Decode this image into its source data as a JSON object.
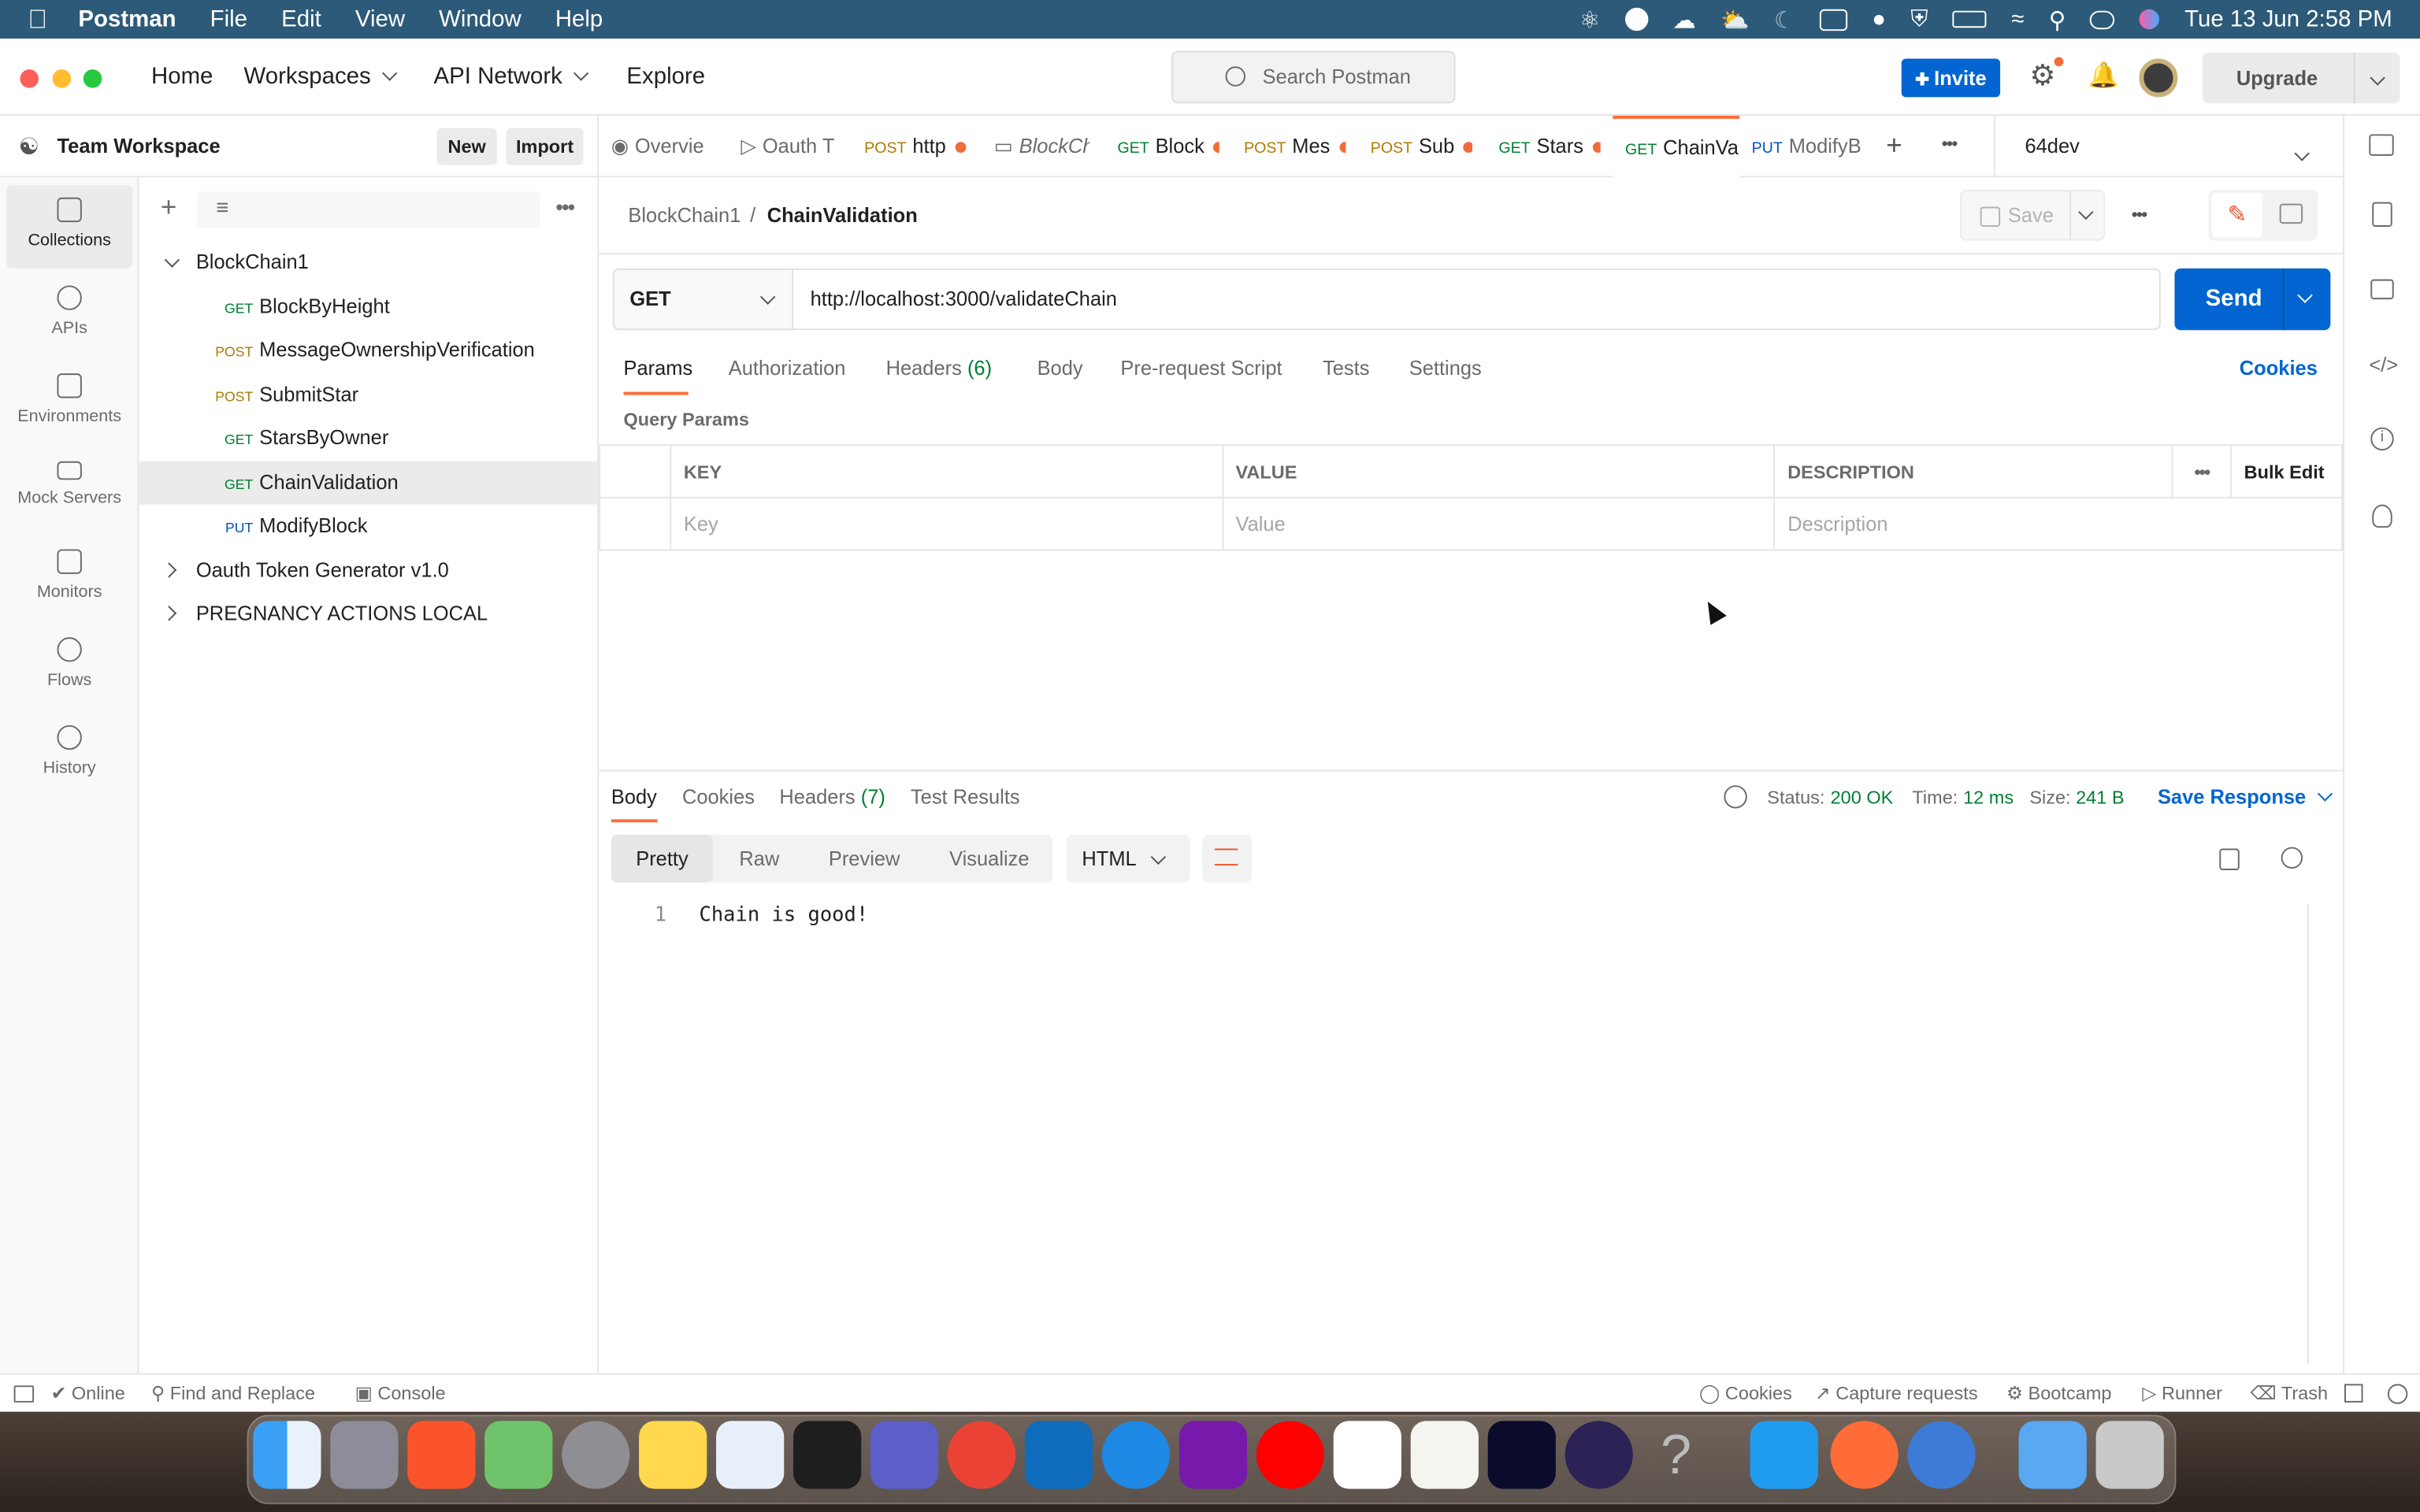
{
  "menubar": {
    "app": "Postman",
    "items": [
      "File",
      "Edit",
      "View",
      "Window",
      "Help"
    ],
    "clock": "Tue 13 Jun  2:58 PM"
  },
  "titlebar": {
    "nav": [
      "Home",
      "Workspaces",
      "API Network",
      "Explore"
    ],
    "search_placeholder": "Search Postman",
    "invite": "Invite",
    "upgrade": "Upgrade"
  },
  "workspace": {
    "name": "Team Workspace",
    "new": "New",
    "import": "Import"
  },
  "rail": [
    "Collections",
    "APIs",
    "Environments",
    "Mock Servers",
    "Monitors",
    "Flows",
    "History"
  ],
  "sidebar": {
    "collections": [
      {
        "name": "BlockChain1",
        "expanded": true
      },
      {
        "name": "Oauth Token Generator v1.0",
        "expanded": false
      },
      {
        "name": "PREGNANCY ACTIONS LOCAL",
        "expanded": false
      }
    ],
    "requests": [
      {
        "method": "GET",
        "name": "BlockByHeight"
      },
      {
        "method": "POST",
        "name": "MessageOwnershipVerification"
      },
      {
        "method": "POST",
        "name": "SubmitStar"
      },
      {
        "method": "GET",
        "name": "StarsByOwner"
      },
      {
        "method": "GET",
        "name": "ChainValidation",
        "selected": true
      },
      {
        "method": "PUT",
        "name": "ModifyBlock"
      }
    ]
  },
  "tabs": [
    {
      "method": "",
      "label": "Overvie",
      "dirty": false
    },
    {
      "method": "",
      "label": "Oauth T",
      "dirty": false
    },
    {
      "method": "POST",
      "label": "http",
      "dirty": true
    },
    {
      "method": "",
      "label": "BlockCh",
      "dirty": false
    },
    {
      "method": "GET",
      "label": "Block",
      "dirty": true
    },
    {
      "method": "POST",
      "label": "Mes",
      "dirty": true
    },
    {
      "method": "POST",
      "label": "Sub",
      "dirty": true
    },
    {
      "method": "GET",
      "label": "Stars",
      "dirty": true
    },
    {
      "method": "GET",
      "label": "ChainVa",
      "dirty": false,
      "active": true
    },
    {
      "method": "PUT",
      "label": "ModifyB",
      "dirty": false
    }
  ],
  "environment": "64dev",
  "request": {
    "breadcrumb_parent": "BlockChain1",
    "breadcrumb_sep": "/",
    "breadcrumb_current": "ChainValidation",
    "save": "Save",
    "method": "GET",
    "url": "http://localhost:3000/validateChain",
    "send": "Send",
    "tabs": [
      "Params",
      "Authorization",
      "Headers",
      "Body",
      "Pre-request Script",
      "Tests",
      "Settings"
    ],
    "headers_count": "(6)",
    "cookies": "Cookies",
    "query_params_title": "Query Params",
    "columns": [
      "KEY",
      "VALUE",
      "DESCRIPTION"
    ],
    "bulk_edit": "Bulk Edit",
    "placeholders": [
      "Key",
      "Value",
      "Description"
    ]
  },
  "response": {
    "tabs": [
      "Body",
      "Cookies",
      "Headers",
      "Test Results"
    ],
    "headers_count": "(7)",
    "status_label": "Status:",
    "status_value": "200 OK",
    "time_label": "Time:",
    "time_value": "12 ms",
    "size_label": "Size:",
    "size_value": "241 B",
    "save_response": "Save Response",
    "formats": [
      "Pretty",
      "Raw",
      "Preview",
      "Visualize"
    ],
    "language": "HTML",
    "line_number": "1",
    "body": "Chain is good!"
  },
  "statusbar": {
    "online": "Online",
    "find_replace": "Find and Replace",
    "console": "Console",
    "cookies": "Cookies",
    "capture": "Capture requests",
    "bootcamp": "Bootcamp",
    "runner": "Runner",
    "trash": "Trash"
  },
  "colors": {
    "accent": "#ff6c37",
    "primary": "#0265d2",
    "get": "#007f31",
    "post": "#ad7a03",
    "put": "#0053b8",
    "menubar": "#2c5a78"
  }
}
